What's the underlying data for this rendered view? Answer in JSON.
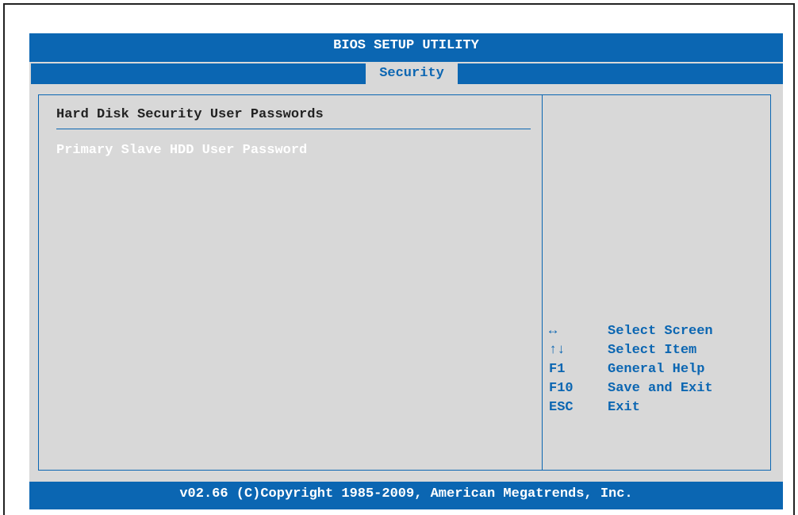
{
  "title": "BIOS SETUP UTILITY",
  "tabs": [
    {
      "label": "Security",
      "active": true
    }
  ],
  "main": {
    "heading": "Hard Disk Security User Passwords",
    "items": [
      {
        "label": "Primary Slave HDD User Password",
        "highlighted": true
      }
    ]
  },
  "help": {
    "keys": [
      {
        "key": "↔",
        "action": "Select Screen"
      },
      {
        "key": "↑↓",
        "action": "Select Item"
      },
      {
        "key": "F1",
        "action": "General Help"
      },
      {
        "key": "F10",
        "action": "Save and Exit"
      },
      {
        "key": "ESC",
        "action": "Exit"
      }
    ]
  },
  "footer": "v02.66 (C)Copyright 1985-2009, American Megatrends, Inc.",
  "colors": {
    "accent": "#0b66b2",
    "panel_bg": "#d8d8d8",
    "heading_text": "#222222",
    "highlight_text": "#ffffff"
  }
}
